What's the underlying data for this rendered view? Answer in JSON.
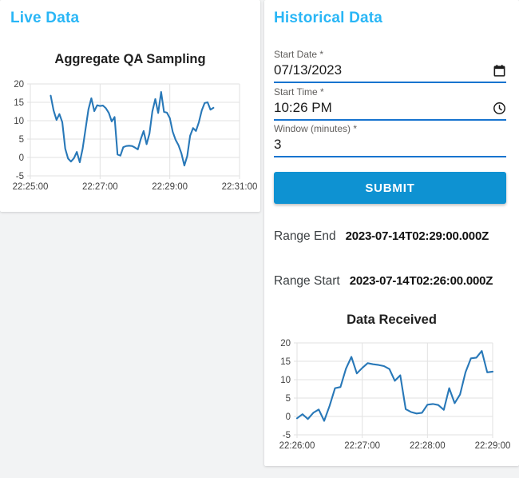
{
  "colors": {
    "header_accent": "#29b6f6",
    "submit_bg": "#0e92d2",
    "underline": "#1774cf",
    "line": "#2878b8",
    "page_bg": "#f2f3f4",
    "card_bg": "#ffffff",
    "grid": "#e2e2e2",
    "tick_text": "#3f3f3f",
    "label_gray": "#605e5c",
    "value_text": "#1b1b1b"
  },
  "live_panel": {
    "header": "Live Data"
  },
  "historical_panel": {
    "header": "Historical Data",
    "fields": [
      {
        "label": "Start Date",
        "required": "*",
        "value": "07/13/2023",
        "icon": "calendar-icon"
      },
      {
        "label": "Start Time",
        "required": "*",
        "value": "10:26 PM",
        "icon": "clock-icon"
      },
      {
        "label": "Window (minutes)",
        "required": "*",
        "value": "3",
        "icon": null
      }
    ],
    "submit_label": "SUBMIT",
    "range_end": {
      "label": "Range End",
      "value": "2023-07-14T02:29:00.000Z"
    },
    "range_start": {
      "label": "Range Start",
      "value": "2023-07-14T02:26:00.000Z"
    }
  },
  "chart_data": [
    {
      "id": "live",
      "type": "line",
      "title": "Aggregate QA Sampling",
      "line_color": "#2878b8",
      "grid": true,
      "legend": "none",
      "x_axis": {
        "min": "22:25:00",
        "max": "22:31:00",
        "ticks": [
          "22:25:00",
          "22:27:00",
          "22:29:00",
          "22:31:00"
        ]
      },
      "y_axis": {
        "min": -5,
        "max": 20,
        "ticks": [
          20,
          15,
          10,
          5,
          0,
          -5
        ]
      },
      "series": [
        {
          "x_start": "22:25:35",
          "x_step_sec": 5,
          "values": [
            16.8,
            12.8,
            10.2,
            11.8,
            9.6,
            2.4,
            -0.3,
            -1.1,
            -0.2,
            1.5,
            -1.3,
            2.4,
            7.7,
            13.1,
            16.1,
            12.6,
            14.2,
            14.0,
            14.1,
            13.4,
            12.1,
            9.8,
            11.0,
            0.8,
            0.5,
            2.8,
            3.1,
            3.2,
            3.1,
            2.7,
            2.2,
            5.0,
            7.2,
            3.6,
            6.5,
            12.5,
            15.9,
            12.1,
            17.8,
            12.4,
            12.2,
            10.7,
            7.0,
            4.8,
            3.3,
            1.1,
            -2.2,
            0.4,
            5.9,
            8.0,
            7.2,
            9.6,
            12.8,
            14.8,
            15.0,
            13.0,
            13.5
          ]
        }
      ]
    },
    {
      "id": "received",
      "type": "line",
      "title": "Data Received",
      "line_color": "#2878b8",
      "grid": true,
      "legend": "none",
      "x_axis": {
        "min": "22:26:00",
        "max": "22:29:00",
        "ticks": [
          "22:26:00",
          "22:27:00",
          "22:28:00",
          "22:29:00"
        ]
      },
      "y_axis": {
        "min": -5,
        "max": 20,
        "ticks": [
          20,
          15,
          10,
          5,
          0,
          -5
        ]
      },
      "series": [
        {
          "x_start": "22:26:00",
          "x_step_sec": 5,
          "values": [
            -0.5,
            0.6,
            -0.7,
            1.0,
            1.9,
            -1.2,
            2.9,
            7.7,
            8.0,
            13.0,
            16.2,
            11.7,
            13.2,
            14.5,
            14.2,
            14.0,
            13.7,
            12.9,
            9.7,
            11.2,
            2.0,
            1.2,
            0.8,
            1.0,
            3.2,
            3.4,
            3.1,
            1.8,
            7.7,
            3.6,
            6.0,
            12.0,
            15.8,
            16.0,
            17.8,
            12.0,
            12.2
          ]
        }
      ]
    }
  ]
}
